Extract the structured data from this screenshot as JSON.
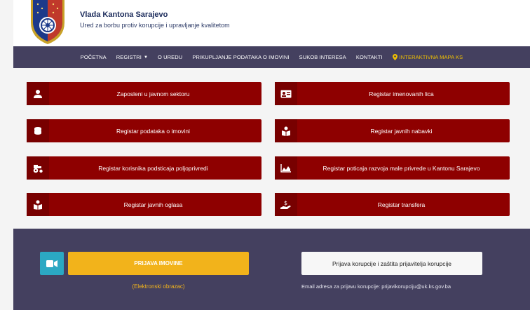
{
  "header": {
    "title": "Vlada Kantona Sarajevo",
    "subtitle": "Ured za borbu protiv korupcije i upravljanje kvalitetom"
  },
  "nav": {
    "items": [
      {
        "label": "POČETNA"
      },
      {
        "label": "REGISTRI"
      },
      {
        "label": "O UREDU"
      },
      {
        "label": "PRIKUPLJANJE PODATAKA O IMOVINI"
      },
      {
        "label": "SUKOB INTERESA"
      },
      {
        "label": "KONTAKTI"
      },
      {
        "label": "INTERAKTIVNA MAPA KS"
      }
    ]
  },
  "registers": [
    {
      "label": "Zaposleni u javnom sektoru",
      "icon": "user-icon"
    },
    {
      "label": "Registar imenovanih lica",
      "icon": "id-card-icon"
    },
    {
      "label": "Registar podataka o imovini",
      "icon": "coins-icon"
    },
    {
      "label": "Registar javnih nabavki",
      "icon": "reader-icon"
    },
    {
      "label": "Registar korisnika podsticaja poljoprivredi",
      "icon": "tractor-icon"
    },
    {
      "label": "Registar poticaja razvoja male privrede u Kantonu Sarajevo",
      "icon": "area-chart-icon"
    },
    {
      "label": "Registar javnih oglasa",
      "icon": "reader-icon"
    },
    {
      "label": "Registar transfera",
      "icon": "hand-money-icon"
    }
  ],
  "footer": {
    "prijava_label": "PRIJAVA IMOVINE",
    "eform_label": "(Elektronski obrazac)",
    "report_label": "Prijava korupcije i zaštita prijavitelja korupcije",
    "email_text": "Email adresa za prijavu korupcije: prijavikorupciju@uk.ks.gov.ba"
  },
  "colors": {
    "nav_bg": "#44405f",
    "button_red": "#8e0000",
    "accent_yellow": "#f2b31b",
    "camera_teal": "#2ba8c3"
  }
}
